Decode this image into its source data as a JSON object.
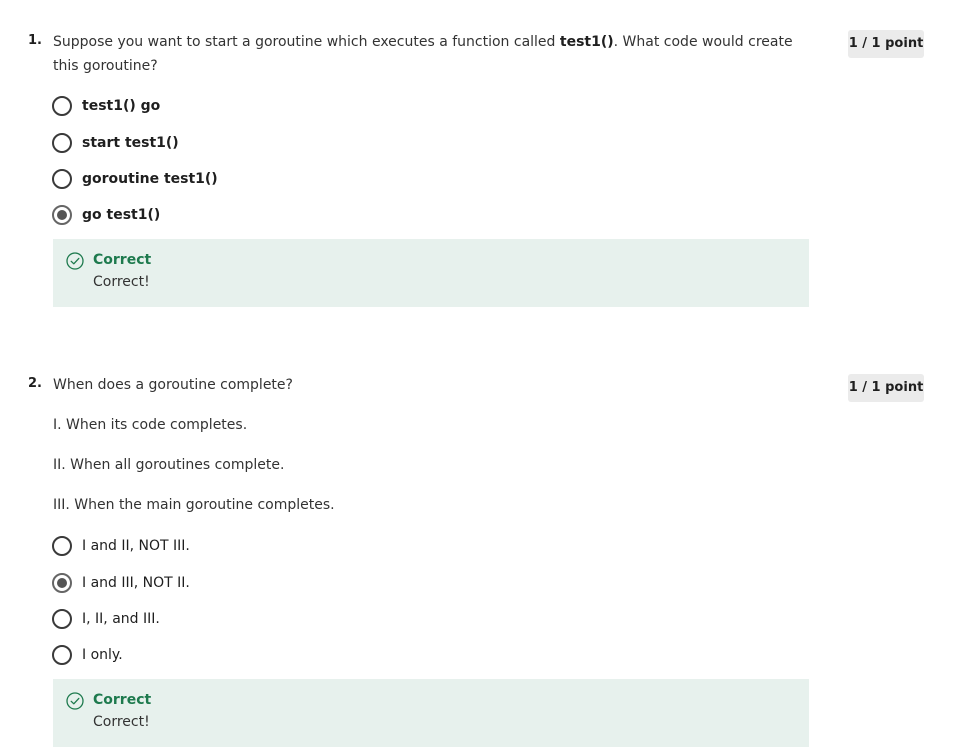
{
  "questions": [
    {
      "number": "1.",
      "text_before": "Suppose you want to start a goroutine which executes a function called ",
      "text_bold": "test1()",
      "text_after": ". What code would create this goroutine?",
      "points": "1 / 1 point",
      "options": [
        {
          "label": "test1()  go",
          "selected": false
        },
        {
          "label": "start test1()",
          "selected": false
        },
        {
          "label": "goroutine test1()",
          "selected": false
        },
        {
          "label": "go test1()",
          "selected": true
        }
      ],
      "feedback": {
        "title": "Correct",
        "text": "Correct!"
      }
    },
    {
      "number": "2.",
      "text": "When does a goroutine complete?",
      "points": "1 / 1 point",
      "statements": [
        "I. When its code completes.",
        "II. When all goroutines complete.",
        "III. When the main goroutine completes."
      ],
      "options": [
        {
          "label": "I and II, NOT III.",
          "selected": false
        },
        {
          "label": "I and III, NOT II.",
          "selected": true
        },
        {
          "label": "I, II, and III.",
          "selected": false
        },
        {
          "label": "I only.",
          "selected": false
        }
      ],
      "feedback": {
        "title": "Correct",
        "text": "Correct!"
      }
    }
  ],
  "colors": {
    "feedback_bg": "#e7f1ed",
    "correct_green": "#1e7a4e",
    "badge_bg": "#ebebeb"
  },
  "icons": {
    "feedback": "check-circle-icon"
  }
}
